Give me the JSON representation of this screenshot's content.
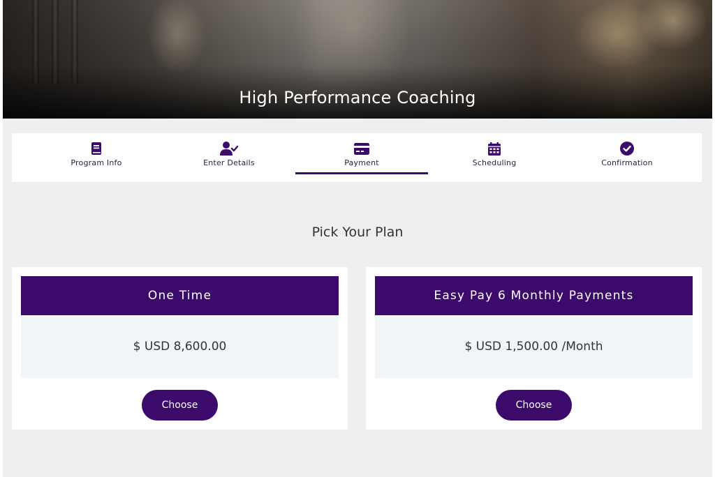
{
  "hero": {
    "title": "High Performance Coaching"
  },
  "steps": [
    {
      "label": "Program Info",
      "icon": "book-icon",
      "active": false
    },
    {
      "label": "Enter Details",
      "icon": "user-check-icon",
      "active": false
    },
    {
      "label": "Payment",
      "icon": "credit-card-icon",
      "active": true
    },
    {
      "label": "Scheduling",
      "icon": "calendar-icon",
      "active": false
    },
    {
      "label": "Confirmation",
      "icon": "check-circle-icon",
      "active": false
    }
  ],
  "plans_section": {
    "title": "Pick Your Plan"
  },
  "plans": [
    {
      "name": "One Time",
      "price": "$ USD 8,600.00",
      "button_label": "Choose"
    },
    {
      "name": "Easy Pay 6 Monthly Payments",
      "price": "$ USD 1,500.00 /Month",
      "button_label": "Choose"
    }
  ],
  "colors": {
    "accent": "#3b0a6b",
    "page_background": "#eeeff1",
    "price_background": "#f1f5f8"
  }
}
